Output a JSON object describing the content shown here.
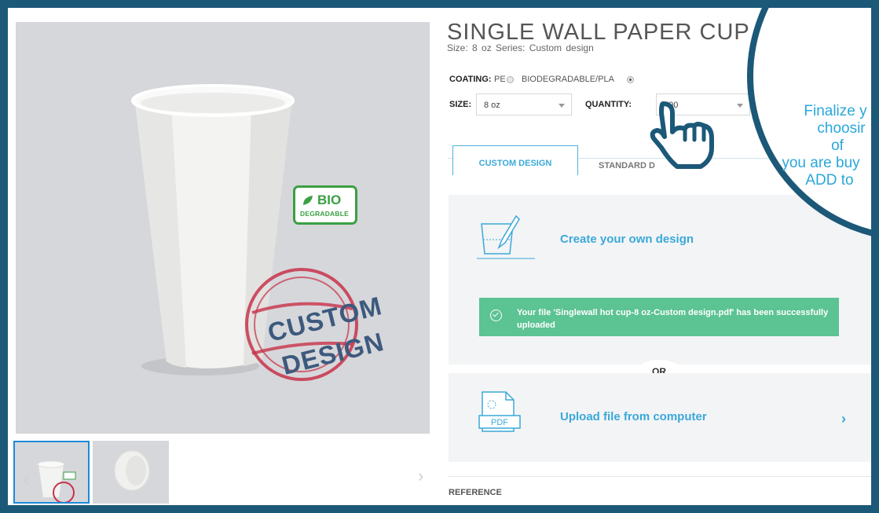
{
  "product": {
    "title": "SINGLE WALL PAPER CUP",
    "subtitle": "Size: 8 oz   Series: Custom design"
  },
  "options": {
    "coating_label": "COATING:",
    "coating_choices": [
      {
        "label": "PE",
        "selected": false
      },
      {
        "label": "BIODEGRADABLE/PLA",
        "selected": true
      }
    ],
    "size_label": "SIZE:",
    "size_value": "8 oz",
    "quantity_label": "QUANTITY:",
    "quantity_value": "500"
  },
  "tabs": {
    "custom": "CUSTOM DESIGN",
    "standard": "STANDARD D"
  },
  "design": {
    "create_label": "Create your own design",
    "success_message": "Your file 'Singlewall hot cup-8 oz-Custom design.pdf' has been successfully uploaded",
    "or_label": "OR",
    "upload_label": "Upload file from computer",
    "pdf_label": "PDF",
    "reference_label": "REFERENCE"
  },
  "image": {
    "bio_badge": "BIO",
    "bio_sub": "DEGRADABLE",
    "stamp_line1": "CUSTOM",
    "stamp_line2": "DESIGN"
  },
  "callout": {
    "lines": [
      "Finalize y",
      "choosir",
      "of",
      "you are buy",
      "ADD to"
    ]
  },
  "colors": {
    "frame": "#1c5878",
    "accent": "#3aa9d9",
    "success": "#5cc393",
    "bio_green": "#3aa043",
    "stamp_red": "#c8324a"
  }
}
